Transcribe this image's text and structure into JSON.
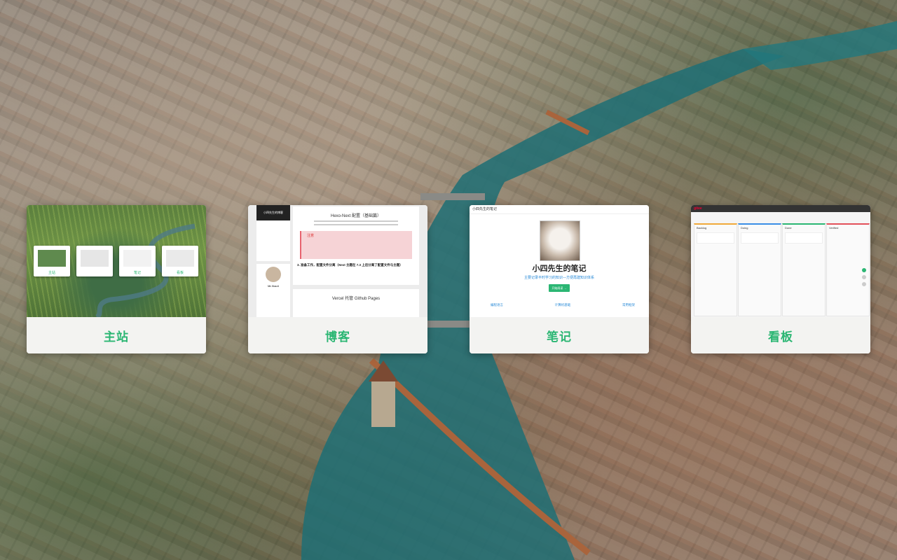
{
  "cards": [
    {
      "label": "主站",
      "minis": [
        "主站",
        "",
        "笔记",
        "看板"
      ]
    },
    {
      "label": "博客",
      "header": "小四先生的博客",
      "post_title": "Hexo-Next 配置（基础篇）",
      "warning_title": "注意",
      "post_subtitle": "3. 准备工作，配置文件分离（Next 主题在 7.3 上后分离了配置文件与主题）",
      "post2_title": "Vercel 托管 Github Pages",
      "profile_name": "Mr.Xiao4"
    },
    {
      "label": "笔记",
      "topbar": "小四先生的笔记",
      "title": "小四先生的笔记",
      "subtitle": "主要记录平时学习的知识—方便再建知识体系",
      "button": "开始阅读 →",
      "sections": [
        "编程语言",
        "计算机基础",
        "常用框架"
      ]
    },
    {
      "label": "看板",
      "topbar_brand": "gitee",
      "columns": [
        "Backlog",
        "Doing",
        "Done",
        "Verified"
      ]
    }
  ],
  "colors": {
    "accent": "#2bb673",
    "card_bg": "#f3f3f1"
  }
}
